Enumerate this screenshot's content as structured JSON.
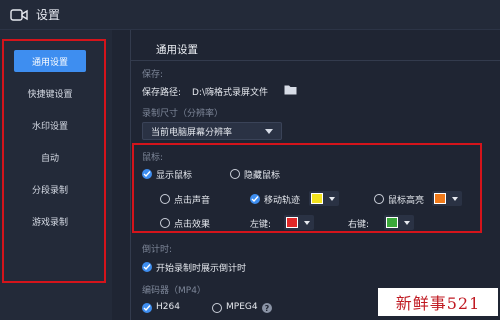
{
  "window": {
    "title": "设置"
  },
  "sidebar": {
    "items": [
      {
        "label": "通用设置",
        "active": true
      },
      {
        "label": "快捷键设置",
        "active": false
      },
      {
        "label": "水印设置",
        "active": false
      },
      {
        "label": "自动",
        "active": false
      },
      {
        "label": "分段录制",
        "active": false
      },
      {
        "label": "游戏录制",
        "active": false
      }
    ]
  },
  "main": {
    "section_title": "通用设置",
    "save": {
      "group_label": "保存:",
      "path_label": "保存路径:",
      "path_value": "D:\\嗨格式录屏文件"
    },
    "record_size": {
      "group_label": "录制尺寸（分辨率）",
      "selected": "当前电脑屏幕分辨率"
    },
    "mouse": {
      "group_label": "鼠标:",
      "show_cursor": "显示鼠标",
      "hide_cursor": "隐藏鼠标",
      "click_sound": "点击声音",
      "move_track": "移动轨迹",
      "cursor_highlight": "鼠标高亮",
      "click_effect": "点击效果",
      "left_key": "左键:",
      "right_key": "右键:"
    },
    "countdown": {
      "group_label": "倒计时:",
      "option": "开始录制时展示倒计时"
    },
    "encoder": {
      "group_label": "编码器（MP4）",
      "h264": "H264",
      "mpeg4": "MPEG4"
    }
  },
  "colors": {
    "accent": "#3e8ef0",
    "highlight_box": "#d4141b",
    "move_track_swatch": "#f2e21e",
    "cursor_highlight_swatch": "#f07a1a",
    "left_key_swatch": "#e02828",
    "right_key_swatch": "#3aa83a"
  },
  "watermark_text": "新鲜事521"
}
